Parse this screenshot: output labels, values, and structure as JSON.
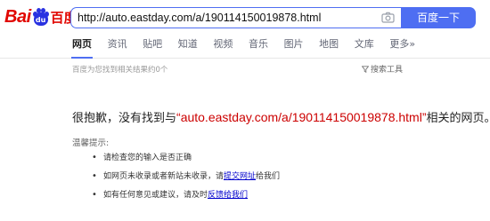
{
  "logo": {
    "text_bai": "Bai",
    "text_du": "du",
    "text_zh": "百度"
  },
  "search": {
    "query": "http://auto.eastday.com/a/190114150019878.html",
    "button_label": "百度一下"
  },
  "nav": {
    "tabs": [
      {
        "label": "网页",
        "active": true
      },
      {
        "label": "资讯"
      },
      {
        "label": "贴吧"
      },
      {
        "label": "知道"
      },
      {
        "label": "视频"
      },
      {
        "label": "音乐"
      },
      {
        "label": "图片"
      },
      {
        "label": "地图"
      },
      {
        "label": "文库"
      },
      {
        "label": "更多»"
      }
    ]
  },
  "result_count": "百度为您找到相关结果约0个",
  "search_tools": "搜索工具",
  "message": {
    "prefix": "很抱歉，没有找到与",
    "open_quote": "“",
    "url": "auto.eastday.com/a/190114150019878.html",
    "close_quote": "”",
    "suffix": "相关的网页。"
  },
  "tips": {
    "title": "温馨提示:",
    "item1": "请检查您的输入是否正确",
    "item2_pre": "如网页未收录或者新站未收录，请",
    "item2_link": "提交网址",
    "item2_post": "给我们",
    "item3_pre": "如有任何意见或建议，请及时",
    "item3_link": "反馈给我们"
  },
  "colors": {
    "brand_red": "#e10601",
    "brand_blue": "#4e6ef2",
    "link_blue": "#0000cc",
    "query_red": "#c00000"
  }
}
